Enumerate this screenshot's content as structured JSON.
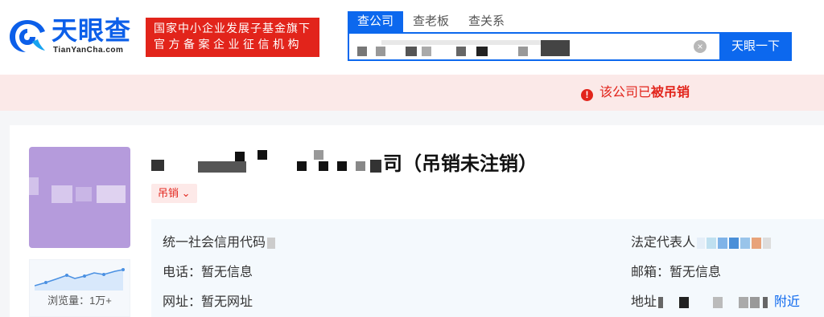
{
  "brand": {
    "name_cn": "天眼查",
    "name_en": "TianYanCha.com"
  },
  "affiliation": {
    "line1": "国家中小企业发展子基金旗下",
    "line2": "官方备案企业征信机构"
  },
  "search": {
    "tabs": [
      "查公司",
      "查老板",
      "查关系"
    ],
    "active_tab": "查公司",
    "query": "",
    "clear_symbol": "×",
    "button": "天眼一下"
  },
  "notice": {
    "prefix": "该公司已",
    "emphasis": "被吊销",
    "icon": "exclamation-icon"
  },
  "company": {
    "name_suffix": "司（吊销未注销）",
    "status_tag": "吊销",
    "status_arrow": "⌄",
    "views_label": "浏览量：1万+",
    "fields": {
      "credit_code_label": "统一社会信用代码",
      "phone": "电话：暂无信息",
      "website": "网址：暂无网址",
      "legal_rep_label": "法定代表人",
      "email": "邮箱：暂无信息",
      "address_label": "地址",
      "nearby": "附近"
    }
  },
  "colors": {
    "brand_blue": "#0c68ee",
    "alert_red": "#e2241b",
    "avatar": "#b59bdc"
  }
}
